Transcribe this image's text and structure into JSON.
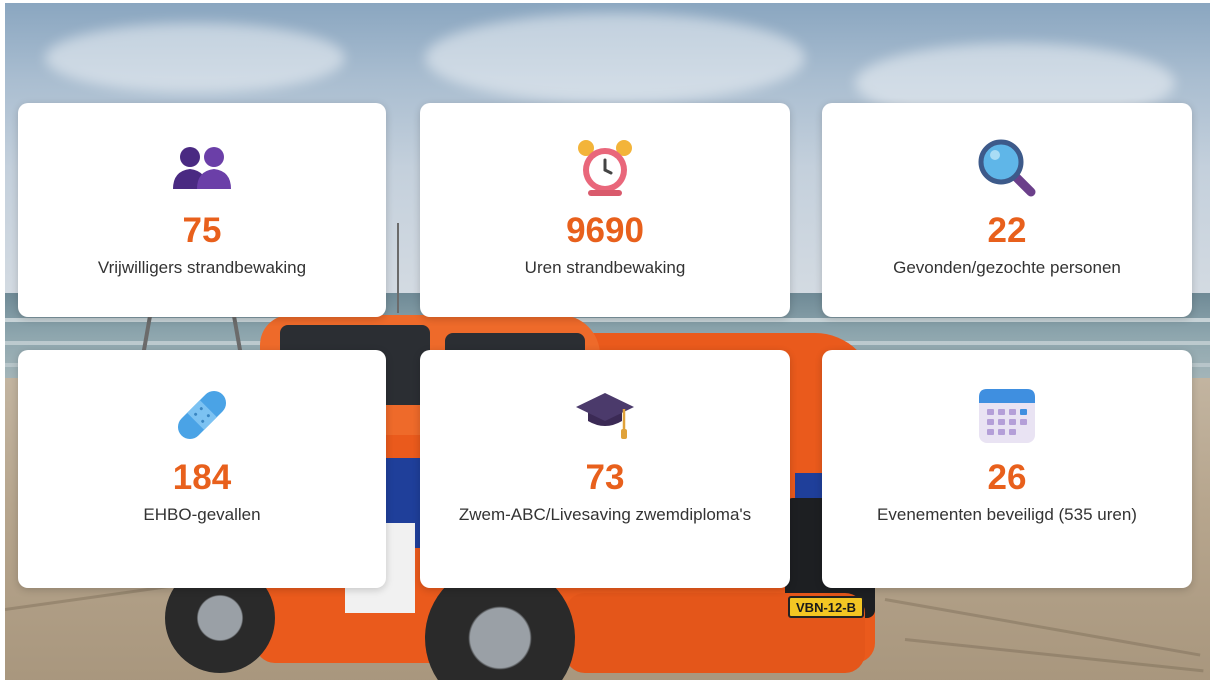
{
  "background": {
    "plate_text": "VBN-12-B"
  },
  "stats": [
    {
      "icon": "people-icon",
      "value": "75",
      "label": "Vrijwilligers strandbewaking"
    },
    {
      "icon": "alarm-clock-icon",
      "value": "9690",
      "label": "Uren strandbewaking"
    },
    {
      "icon": "magnifying-glass-icon",
      "value": "22",
      "label": "Gevonden/gezochte personen"
    },
    {
      "icon": "bandage-icon",
      "value": "184",
      "label": "EHBO-gevallen"
    },
    {
      "icon": "graduation-cap-icon",
      "value": "73",
      "label": "Zwem-ABC/Livesaving zwemdiploma's"
    },
    {
      "icon": "calendar-icon",
      "value": "26",
      "label": "Evenementen beveiligd (535 uren)"
    }
  ],
  "colors": {
    "accent": "#e8601c",
    "card_bg": "#ffffff",
    "label_text": "#333333"
  }
}
